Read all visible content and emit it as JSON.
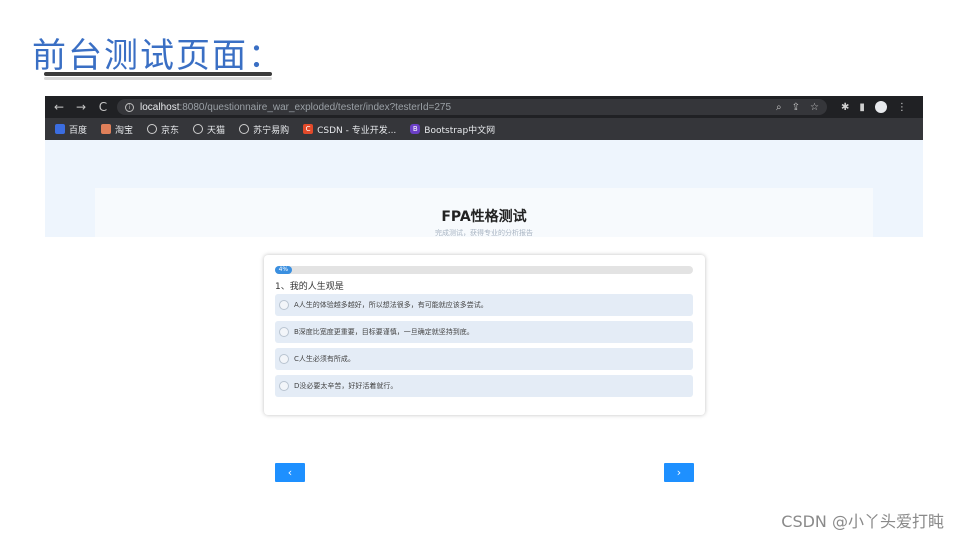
{
  "slide": {
    "title": "前台测试页面："
  },
  "browser": {
    "nav": {
      "back": "←",
      "forward": "→",
      "reload": "C"
    },
    "url": {
      "host": "localhost",
      "rest": ":8080/questionnaire_war_exploded/tester/index?testerId=275"
    },
    "bookmarks": [
      {
        "label": "百度"
      },
      {
        "label": "淘宝"
      },
      {
        "label": "京东"
      },
      {
        "label": "天猫"
      },
      {
        "label": "苏宁易购"
      },
      {
        "label": "CSDN - 专业开发..."
      },
      {
        "label": "Bootstrap中文网"
      }
    ],
    "bookmark_badges": {
      "csdn": "C",
      "bootstrap": "B"
    }
  },
  "page": {
    "title": "FPA性格测试",
    "subtitle": "完成测试，获得专业的分析报告",
    "progress": {
      "label": "4%",
      "value": 4
    },
    "question": "1、我的人生观是",
    "options": [
      {
        "text": "A人生的体验越多越好，所以想法很多，有可能就应该多尝试。"
      },
      {
        "text": "B深度比宽度更重要，目标要谨慎，一旦确定就坚持到底。"
      },
      {
        "text": "C人生必须有所成。"
      },
      {
        "text": "D没必要太辛苦，好好活着就行。"
      }
    ],
    "prev": "‹",
    "next": "›"
  },
  "watermark": "CSDN @小丫头爱打盹",
  "colors": {
    "accent": "#1e90ff",
    "title_blue": "#3a6fc4",
    "chrome_dark": "#202124"
  }
}
